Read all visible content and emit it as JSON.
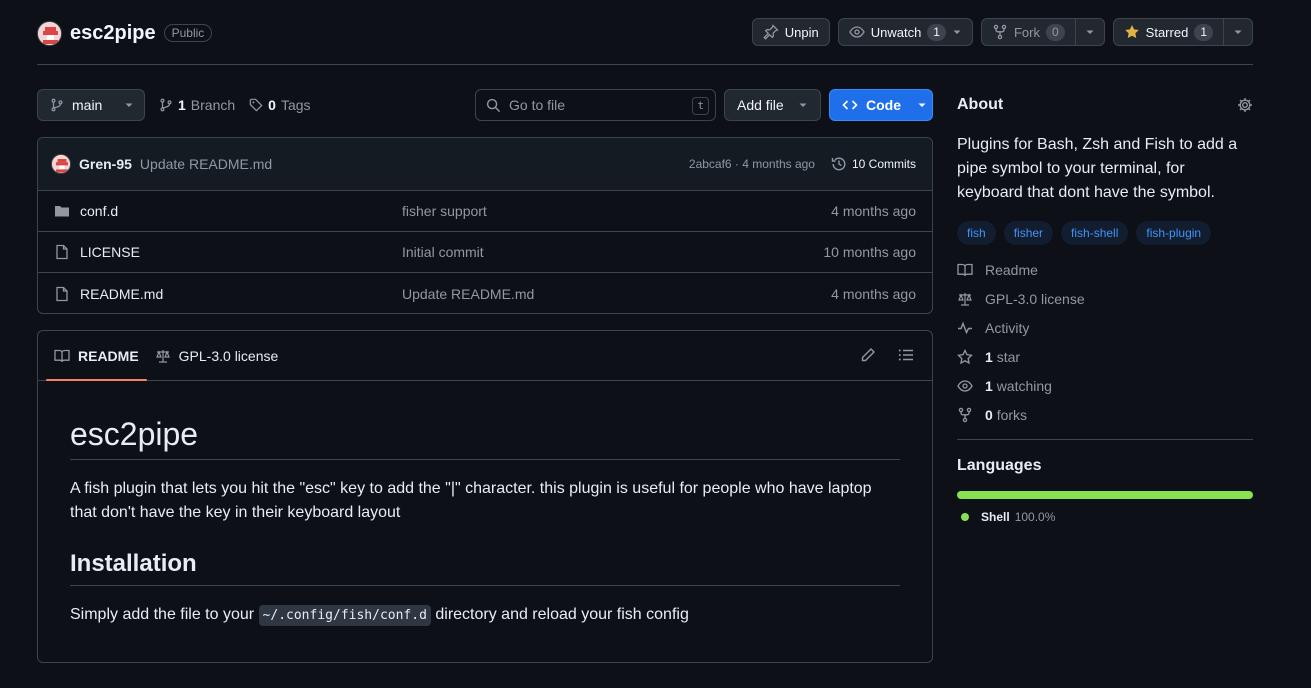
{
  "repo": {
    "name": "esc2pipe",
    "visibility": "Public"
  },
  "actions": {
    "unpin": "Unpin",
    "unwatch": "Unwatch",
    "watch_count": "1",
    "fork": "Fork",
    "fork_count": "0",
    "starred": "Starred",
    "star_count": "1"
  },
  "toolbar": {
    "branch": "main",
    "branch_count": "1",
    "branch_label": "Branch",
    "tag_count": "0",
    "tag_label": "Tags",
    "goto_placeholder": "Go to file",
    "goto_key": "t",
    "add_file": "Add file",
    "code": "Code"
  },
  "commit": {
    "author": "Gren-95",
    "message": "Update README.md",
    "meta": "2abcaf6 · 4 months ago",
    "commits": "10 Commits"
  },
  "files": [
    {
      "name": "conf.d",
      "type": "folder",
      "message": "fisher support",
      "date": "4 months ago"
    },
    {
      "name": "LICENSE",
      "type": "file",
      "message": "Initial commit",
      "date": "10 months ago"
    },
    {
      "name": "README.md",
      "type": "file",
      "message": "Update README.md",
      "date": "4 months ago"
    }
  ],
  "readme": {
    "tab_readme": "README",
    "tab_license": "GPL-3.0 license",
    "title": "esc2pipe",
    "intro": "A fish plugin that lets you hit the \"esc\" key to add the \"|\" character. this plugin is useful for people who have laptop that don't have the key in their keyboard layout",
    "h2": "Installation",
    "install_pre": "Simply add the file to your ",
    "install_code": "~/.config/fish/conf.d",
    "install_post": " directory and reload your fish config"
  },
  "about": {
    "title": "About",
    "description": "Plugins for Bash, Zsh and Fish to add a pipe symbol to your terminal, for keyboard that dont have the symbol.",
    "topics": [
      "fish",
      "fisher",
      "fish-shell",
      "fish-plugin"
    ],
    "readme": "Readme",
    "license": "GPL-3.0 license",
    "activity": "Activity",
    "stars_count": "1",
    "stars_label": "star",
    "watching_count": "1",
    "watching_label": "watching",
    "forks_count": "0",
    "forks_label": "forks"
  },
  "languages": {
    "title": "Languages",
    "items": [
      {
        "name": "Shell",
        "percent": "100.0%",
        "color": "#89e051"
      }
    ]
  }
}
